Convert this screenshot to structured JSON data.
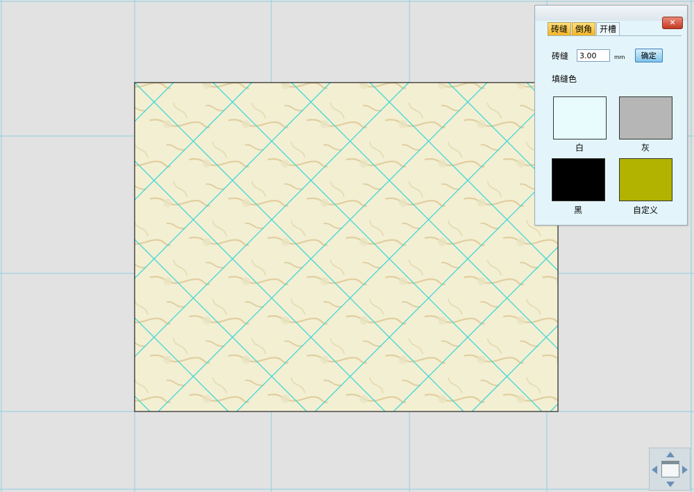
{
  "canvas": {
    "background": "#e2e2e2",
    "guide_color": "#8ecfe0",
    "tile_grout_color": "#3cd6d6",
    "tile_base_color": "#f3efd3"
  },
  "panel": {
    "close_label": "✕",
    "tabs": [
      {
        "label": "砖缝",
        "active": true
      },
      {
        "label": "倒角",
        "active": true
      },
      {
        "label": "开槽",
        "active": false
      }
    ],
    "gap_label": "砖缝",
    "gap_value": "3.00",
    "gap_unit": "mm",
    "confirm_label": "确定",
    "fill_color_title": "填缝色",
    "swatches": [
      {
        "label": "白",
        "color": "#e8fbfd"
      },
      {
        "label": "灰",
        "color": "#b6b6b6"
      },
      {
        "label": "黑",
        "color": "#000000"
      },
      {
        "label": "自定义",
        "color": "#b2b200"
      }
    ]
  },
  "navigator": {
    "up_icon": "arrow-up-icon",
    "down_icon": "arrow-down-icon",
    "left_icon": "arrow-left-icon",
    "right_icon": "arrow-right-icon"
  }
}
